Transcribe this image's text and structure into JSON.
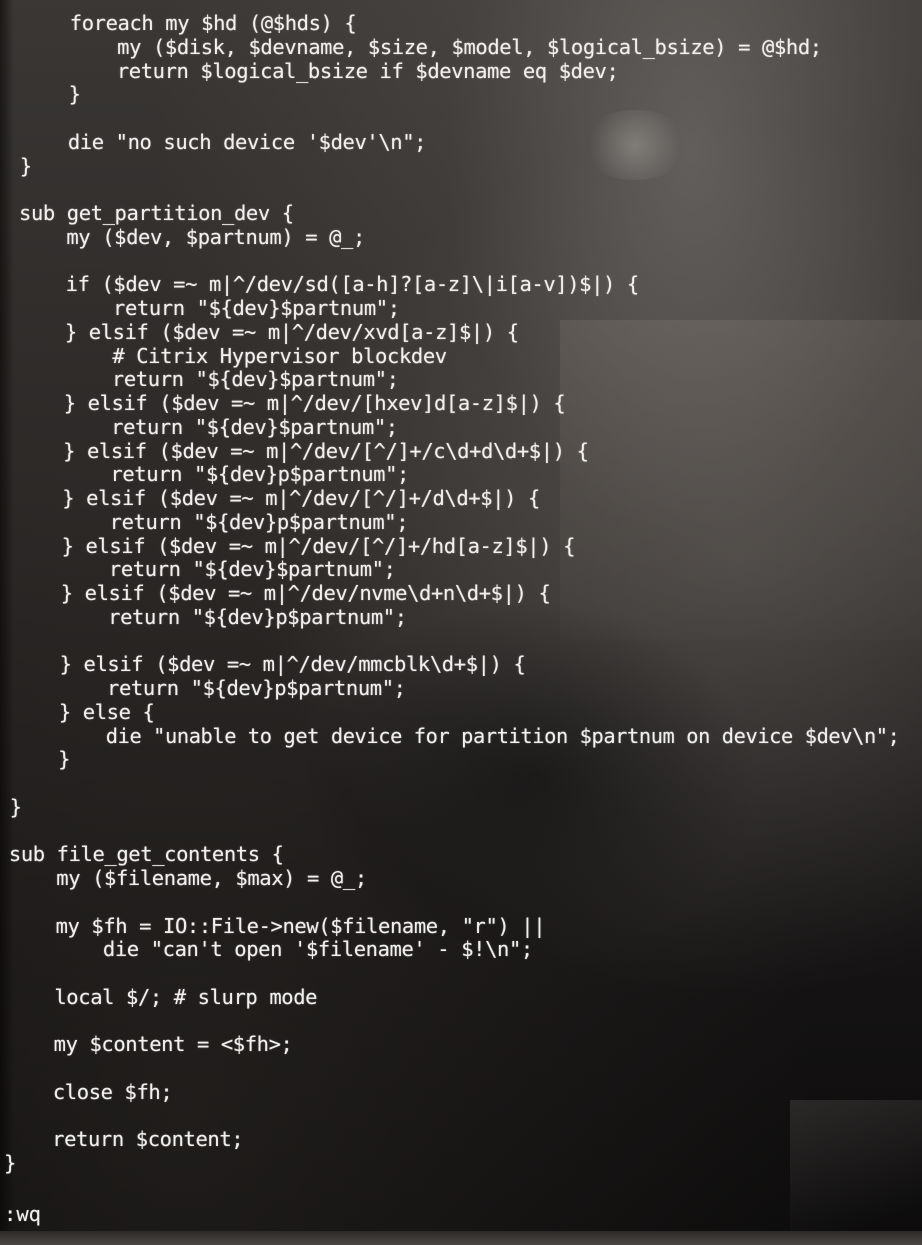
{
  "editor": {
    "lines": [
      "    foreach my $hd (@$hds) {",
      "        my ($disk, $devname, $size, $model, $logical_bsize) = @$hd;",
      "        return $logical_bsize if $devname eq $dev;",
      "    }",
      "",
      "    die \"no such device '$dev'\\n\";",
      "}",
      "",
      "sub get_partition_dev {",
      "    my ($dev, $partnum) = @_;",
      "",
      "    if ($dev =~ m|^/dev/sd([a-h]?[a-z]\\|i[a-v])$|) {",
      "        return \"${dev}$partnum\";",
      "    } elsif ($dev =~ m|^/dev/xvd[a-z]$|) {",
      "        # Citrix Hypervisor blockdev",
      "        return \"${dev}$partnum\";",
      "    } elsif ($dev =~ m|^/dev/[hxev]d[a-z]$|) {",
      "        return \"${dev}$partnum\";",
      "    } elsif ($dev =~ m|^/dev/[^/]+/c\\d+d\\d+$|) {",
      "        return \"${dev}p$partnum\";",
      "    } elsif ($dev =~ m|^/dev/[^/]+/d\\d+$|) {",
      "        return \"${dev}p$partnum\";",
      "    } elsif ($dev =~ m|^/dev/[^/]+/hd[a-z]$|) {",
      "        return \"${dev}$partnum\";",
      "    } elsif ($dev =~ m|^/dev/nvme\\d+n\\d+$|) {",
      "        return \"${dev}p$partnum\";",
      "",
      "    } elsif ($dev =~ m|^/dev/mmcblk\\d+$|) {",
      "        return \"${dev}p$partnum\";",
      "    } else {",
      "        die \"unable to get device for partition $partnum on device $dev\\n\";",
      "    }",
      "",
      "}",
      "",
      "sub file_get_contents {",
      "    my ($filename, $max) = @_;",
      "",
      "    my $fh = IO::File->new($filename, \"r\") ||",
      "        die \"can't open '$filename' - $!\\n\";",
      "",
      "    local $/; # slurp mode",
      "",
      "    my $content = <$fh>;",
      "",
      "    close $fh;",
      "",
      "    return $content;",
      "}"
    ],
    "command_line": ":wq"
  }
}
